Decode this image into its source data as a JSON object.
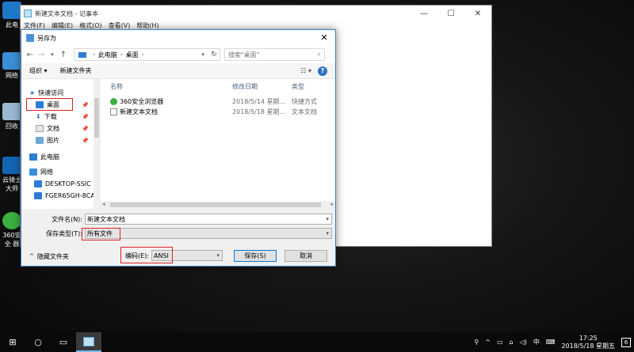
{
  "desktop": {
    "icons": [
      "此电",
      "网络",
      "回收",
      "云骑士 大师",
      "360安全 器"
    ]
  },
  "notepad": {
    "title": "新建文本文档 - 记事本",
    "menu": [
      "文件(F)",
      "编辑(E)",
      "格式(O)",
      "查看(V)",
      "帮助(H)"
    ],
    "controls": [
      "—",
      "☐",
      "✕"
    ]
  },
  "dialog": {
    "title": "另存为",
    "close": "✕",
    "address": {
      "root": "此电脑",
      "current": "桌面"
    },
    "search_placeholder": "搜索\"桌面\"",
    "toolbar": {
      "organize": "组织 ▾",
      "new_folder": "新建文件夹",
      "help": "?"
    },
    "nav": {
      "quick_access": "快速访问",
      "desktop": "桌面",
      "downloads": "下载",
      "documents": "文档",
      "pictures": "图片",
      "this_pc": "此电脑",
      "network": "网络",
      "pc1": "DESKTOP-SSIC",
      "pc2": "FGER65GH-8CA"
    },
    "columns": {
      "name": "名称",
      "date": "修改日期",
      "type": "类型"
    },
    "files": [
      {
        "name": "360安全浏览器",
        "date": "2018/5/14 星期...",
        "type": "快捷方式"
      },
      {
        "name": "新建文本文档",
        "date": "2018/5/18 星期...",
        "type": "文本文档"
      }
    ],
    "filename_label": "文件名(N):",
    "filename_value": "新建文本文档",
    "savetype_label": "保存类型(T):",
    "savetype_value": "所有文件",
    "hide_folders": "隐藏文件夹",
    "encoding_label": "编码(E):",
    "encoding_value": "ANSI",
    "save_button": "保存(S)",
    "cancel_button": "取消"
  },
  "taskbar": {
    "clock_time": "17:25",
    "clock_date": "2018/5/18 星期五",
    "ime": "中",
    "notification_count": "6"
  },
  "colors": {
    "highlight_red": "#e02020",
    "accent": "#0078d7"
  }
}
